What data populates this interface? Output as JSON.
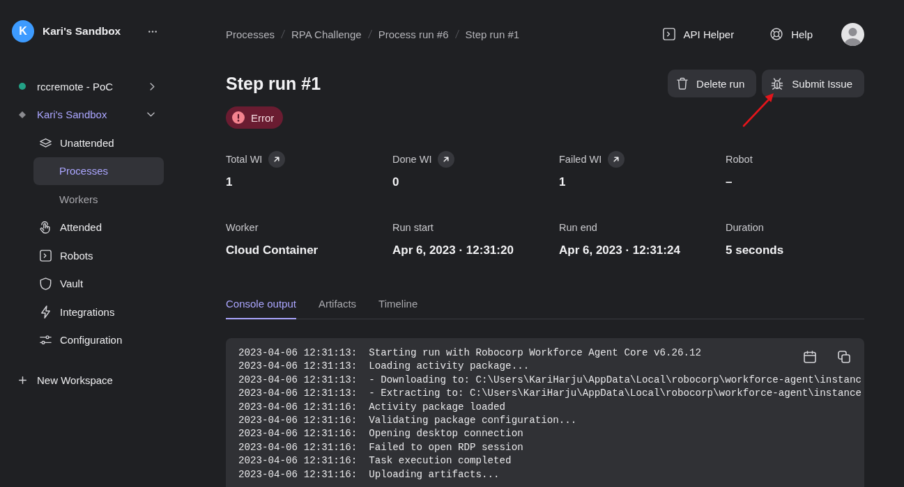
{
  "sidebar": {
    "workspace": {
      "initial": "K",
      "name": "Kari's Sandbox"
    },
    "workspaces": [
      {
        "name": "rccremote - PoC",
        "kind": "dot",
        "color": "#23a186",
        "selected": false,
        "expanded": false
      },
      {
        "name": "Kari's Sandbox",
        "kind": "diamond",
        "color": "#8b8b90",
        "selected": true,
        "expanded": true,
        "children": [
          {
            "label": "Unattended",
            "selected": false,
            "children": [
              {
                "label": "Processes",
                "selected": true
              },
              {
                "label": "Workers",
                "selected": false
              }
            ]
          },
          {
            "label": "Attended",
            "selected": false
          },
          {
            "label": "Robots",
            "selected": false
          },
          {
            "label": "Vault",
            "selected": false
          },
          {
            "label": "Integrations",
            "selected": false
          },
          {
            "label": "Configuration",
            "selected": false
          }
        ]
      }
    ],
    "new_workspace": "New Workspace"
  },
  "header": {
    "breadcrumbs": [
      "Processes",
      "RPA Challenge",
      "Process run #6",
      "Step run #1"
    ],
    "links": [
      {
        "label": "API Helper"
      },
      {
        "label": "Help"
      }
    ]
  },
  "page": {
    "title": "Step run #1",
    "status": {
      "label": "Error",
      "kind": "error"
    },
    "actions": [
      {
        "label": "Delete run"
      },
      {
        "label": "Submit Issue"
      }
    ],
    "stats": [
      {
        "label": "Total WI",
        "value": "1",
        "link": true
      },
      {
        "label": "Done WI",
        "value": "0",
        "link": true
      },
      {
        "label": "Failed WI",
        "value": "1",
        "link": true
      },
      {
        "label": "Robot",
        "value": "–",
        "link": false
      },
      {
        "label": "Worker",
        "value": "Cloud Container",
        "link": false
      },
      {
        "label": "Run start",
        "value": "Apr 6, 2023 · 12:31:20",
        "link": false
      },
      {
        "label": "Run end",
        "value": "Apr 6, 2023 · 12:31:24",
        "link": false
      },
      {
        "label": "Duration",
        "value": "5 seconds",
        "link": false
      }
    ],
    "tabs": [
      {
        "label": "Console output",
        "selected": true
      },
      {
        "label": "Artifacts",
        "selected": false
      },
      {
        "label": "Timeline",
        "selected": false
      }
    ],
    "console": {
      "lines": [
        {
          "time": "2023-04-06 12:31:13:",
          "text": "Starting run with Robocorp Workforce Agent Core v6.26.12"
        },
        {
          "time": "2023-04-06 12:31:13:",
          "text": "Loading activity package..."
        },
        {
          "time": "2023-04-06 12:31:13:",
          "text": "- Downloading to: C:\\Users\\KariHarju\\AppData\\Local\\robocorp\\workforce-agent\\instanc"
        },
        {
          "time": "2023-04-06 12:31:13:",
          "text": "- Extracting to: C:\\Users\\KariHarju\\AppData\\Local\\robocorp\\workforce-agent\\instance"
        },
        {
          "time": "2023-04-06 12:31:16:",
          "text": "Activity package loaded"
        },
        {
          "time": "2023-04-06 12:31:16:",
          "text": "Validating package configuration..."
        },
        {
          "time": "2023-04-06 12:31:16:",
          "text": "Opening desktop connection"
        },
        {
          "time": "2023-04-06 12:31:16:",
          "text": "Failed to open RDP session"
        },
        {
          "time": "2023-04-06 12:31:16:",
          "text": "Task execution completed"
        },
        {
          "time": "2023-04-06 12:31:16:",
          "text": "Uploading artifacts..."
        }
      ]
    }
  }
}
